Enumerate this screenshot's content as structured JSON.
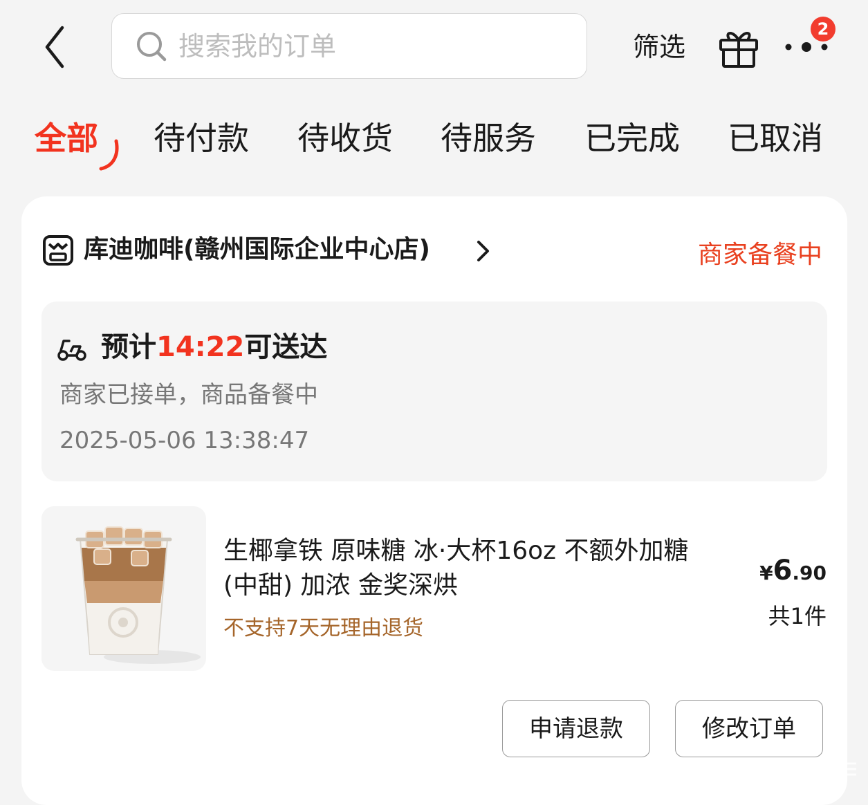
{
  "header": {
    "search_placeholder": "搜索我的订单",
    "filter_label": "筛选",
    "badge_count": "2"
  },
  "tabs": [
    {
      "label": "全部",
      "active": true
    },
    {
      "label": "待付款",
      "active": false
    },
    {
      "label": "待收货",
      "active": false
    },
    {
      "label": "待服务",
      "active": false
    },
    {
      "label": "已完成",
      "active": false
    },
    {
      "label": "已取消",
      "active": false
    }
  ],
  "order": {
    "store_name": "库迪咖啡(赣州国际企业中心店)",
    "status": "商家备餐中",
    "eta_prefix": "预计",
    "eta_time": "14:22",
    "eta_suffix": "可送达",
    "status_desc": "商家已接单，商品备餐中",
    "timestamp": "2025-05-06 13:38:47",
    "product": {
      "name": "生椰拿铁 原味糖 冰·大杯16oz 不额外加糖(中甜) 加浓 金奖深烘",
      "return_note": "不支持7天无理由退货",
      "price_currency": "¥",
      "price_integer": "6",
      "price_decimal": ".90",
      "quantity": "共1件"
    },
    "actions": {
      "refund_label": "申请退款",
      "modify_label": "修改订单"
    }
  },
  "colors": {
    "accent": "#f2331f",
    "status": "#e9401f",
    "note": "#a5652a"
  },
  "icons": [
    "back-arrow-icon",
    "search-icon",
    "gift-icon",
    "more-icon",
    "store-icon",
    "chevron-right-icon",
    "scooter-icon"
  ]
}
